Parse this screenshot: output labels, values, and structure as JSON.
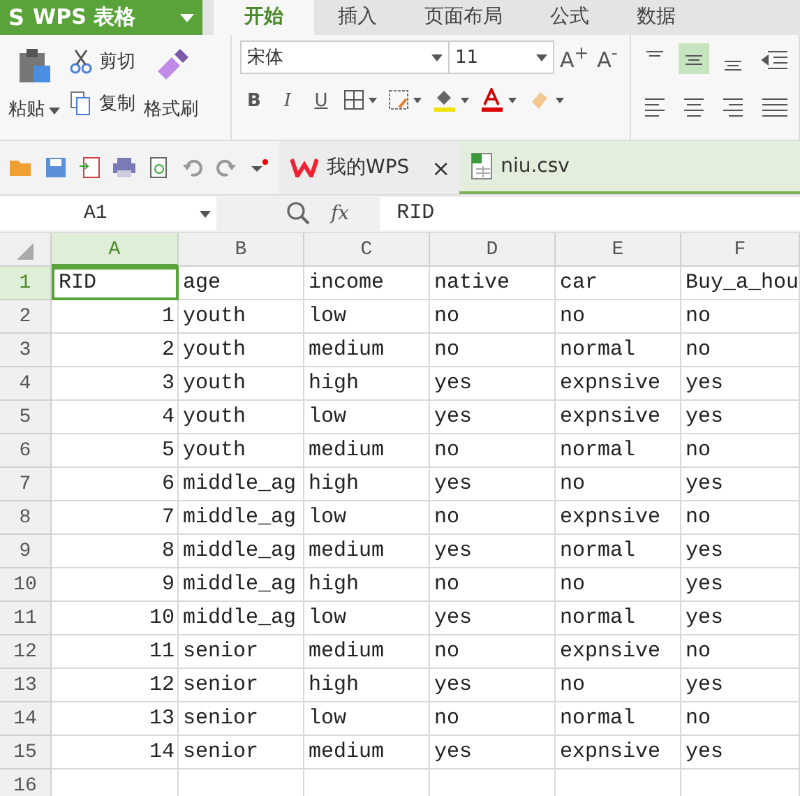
{
  "app": {
    "logo": "S",
    "title": "WPS 表格"
  },
  "tabs": [
    {
      "label": "开始",
      "selected": true
    },
    {
      "label": "插入",
      "selected": false
    },
    {
      "label": "页面布局",
      "selected": false
    },
    {
      "label": "公式",
      "selected": false
    },
    {
      "label": "数据",
      "selected": false
    }
  ],
  "ribbon": {
    "paste": "粘贴",
    "cut": "剪切",
    "copy": "复制",
    "format_painter": "格式刷",
    "font": "宋体",
    "font_size": "11",
    "grow": "A$^{+}$",
    "shrink": "A$^{-}$",
    "bold": "B",
    "italic": "I",
    "underline": "U"
  },
  "doc_tabs": [
    {
      "label": "我的WPS",
      "selected": false,
      "kind": "home",
      "close": "×"
    },
    {
      "label": "niu.csv",
      "selected": true,
      "kind": "sheet"
    }
  ],
  "formula_bar": {
    "cell": "A1",
    "fx": "fx",
    "value": "RID"
  },
  "sheet": {
    "columns": [
      {
        "label": "A",
        "selected": true
      },
      {
        "label": "B",
        "selected": false
      },
      {
        "label": "C",
        "selected": false
      },
      {
        "label": "D",
        "selected": false
      },
      {
        "label": "E",
        "selected": false
      },
      {
        "label": "F",
        "selected": false
      }
    ],
    "rows": [
      {
        "number": "1",
        "selected": true,
        "cells": [
          "RID",
          "age",
          "income",
          "native",
          "car",
          "Buy_a_hou"
        ]
      },
      {
        "number": "2",
        "selected": false,
        "cells": [
          "1",
          "youth",
          "low",
          "no",
          "no",
          "no"
        ]
      },
      {
        "number": "3",
        "selected": false,
        "cells": [
          "2",
          "youth",
          "medium",
          "no",
          "normal",
          "no"
        ]
      },
      {
        "number": "4",
        "selected": false,
        "cells": [
          "3",
          "youth",
          "high",
          "yes",
          "expnsive",
          "yes"
        ]
      },
      {
        "number": "5",
        "selected": false,
        "cells": [
          "4",
          "youth",
          "low",
          "yes",
          "expnsive",
          "yes"
        ]
      },
      {
        "number": "6",
        "selected": false,
        "cells": [
          "5",
          "youth",
          "medium",
          "no",
          "normal",
          "no"
        ]
      },
      {
        "number": "7",
        "selected": false,
        "cells": [
          "6",
          "middle_ag",
          "high",
          "yes",
          "no",
          "yes"
        ]
      },
      {
        "number": "8",
        "selected": false,
        "cells": [
          "7",
          "middle_ag",
          "low",
          "no",
          "expnsive",
          "no"
        ]
      },
      {
        "number": "9",
        "selected": false,
        "cells": [
          "8",
          "middle_ag",
          "medium",
          "yes",
          "normal",
          "yes"
        ]
      },
      {
        "number": "10",
        "selected": false,
        "cells": [
          "9",
          "middle_ag",
          "high",
          "no",
          "no",
          "yes"
        ]
      },
      {
        "number": "11",
        "selected": false,
        "cells": [
          "10",
          "middle_ag",
          "low",
          "yes",
          "normal",
          "yes"
        ]
      },
      {
        "number": "12",
        "selected": false,
        "cells": [
          "11",
          "senior",
          "medium",
          "no",
          "expnsive",
          "no"
        ]
      },
      {
        "number": "13",
        "selected": false,
        "cells": [
          "12",
          "senior",
          "high",
          "yes",
          "no",
          "yes"
        ]
      },
      {
        "number": "14",
        "selected": false,
        "cells": [
          "13",
          "senior",
          "low",
          "no",
          "normal",
          "no"
        ]
      },
      {
        "number": "15",
        "selected": false,
        "cells": [
          "14",
          "senior",
          "medium",
          "yes",
          "expnsive",
          "yes"
        ]
      },
      {
        "number": "16",
        "selected": false,
        "cells": []
      }
    ]
  }
}
